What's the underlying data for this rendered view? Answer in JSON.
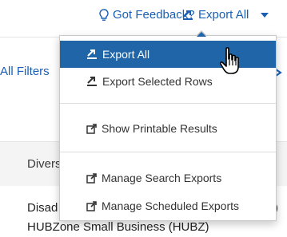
{
  "header": {
    "feedback_label": "Got Feedback?",
    "export_label": "Export All"
  },
  "toolbar": {
    "filters_label": "All Filters"
  },
  "table": {
    "column_header": "Divers",
    "row1_text": "Disad",
    "row1_suffix": ")",
    "row2_text": "HUBZone Small Business (HUBZ)"
  },
  "menu": {
    "items": [
      {
        "label": "Export All",
        "icon": "export-icon",
        "selected": true
      },
      {
        "label": "Export Selected Rows",
        "icon": "export-icon",
        "selected": false
      },
      {
        "label": "Show Printable Results",
        "icon": "external-link-icon",
        "selected": false
      },
      {
        "label": "Manage Search Exports",
        "icon": "external-link-icon",
        "selected": false
      },
      {
        "label": "Manage Scheduled Exports",
        "icon": "external-link-icon",
        "selected": false
      }
    ]
  },
  "colors": {
    "link": "#1a5fb4",
    "menu_highlight": "#1f65a8"
  }
}
